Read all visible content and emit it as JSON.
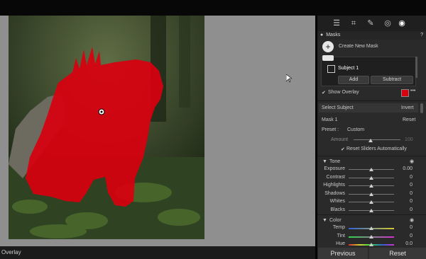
{
  "colors": {
    "mask_overlay": "#d9000f",
    "panel_bg": "#2a2a2a",
    "canvas_bg": "#8f8f8f",
    "accent_blue": "#2f63d6"
  },
  "status": {
    "overlay_label": "Overlay"
  },
  "toolbar": {
    "icons": [
      "edit-sliders-icon",
      "crop-icon",
      "heal-icon",
      "redeye-icon",
      "masking-icon"
    ]
  },
  "masks": {
    "title": "Masks",
    "create_label": "Create New Mask",
    "subject_label": "Subject 1",
    "add_label": "Add",
    "subtract_label": "Subtract",
    "show_overlay_label": "Show Overlay"
  },
  "subject_bar": {
    "select_label": "Select Subject",
    "invert_label": "Invert"
  },
  "mask_settings": {
    "mask_label": "Mask 1",
    "reset_label": "Reset",
    "preset_label": "Preset :",
    "preset_value": "Custom",
    "amount_label": "Amount",
    "amount_value": "100",
    "reset_sliders_label": "Reset Sliders Automatically"
  },
  "tone": {
    "title": "Tone",
    "sliders": [
      {
        "label": "Exposure",
        "value": "0.00"
      },
      {
        "label": "Contrast",
        "value": "0"
      },
      {
        "label": "Highlights",
        "value": "0"
      },
      {
        "label": "Shadows",
        "value": "0"
      },
      {
        "label": "Whites",
        "value": "0"
      },
      {
        "label": "Blacks",
        "value": "0"
      }
    ]
  },
  "color": {
    "title": "Color",
    "sliders": [
      {
        "label": "Temp",
        "value": "0"
      },
      {
        "label": "Tint",
        "value": "0"
      },
      {
        "label": "Hue",
        "value": "0.0"
      }
    ]
  },
  "footer": {
    "previous_label": "Previous",
    "reset_label": "Reset"
  }
}
